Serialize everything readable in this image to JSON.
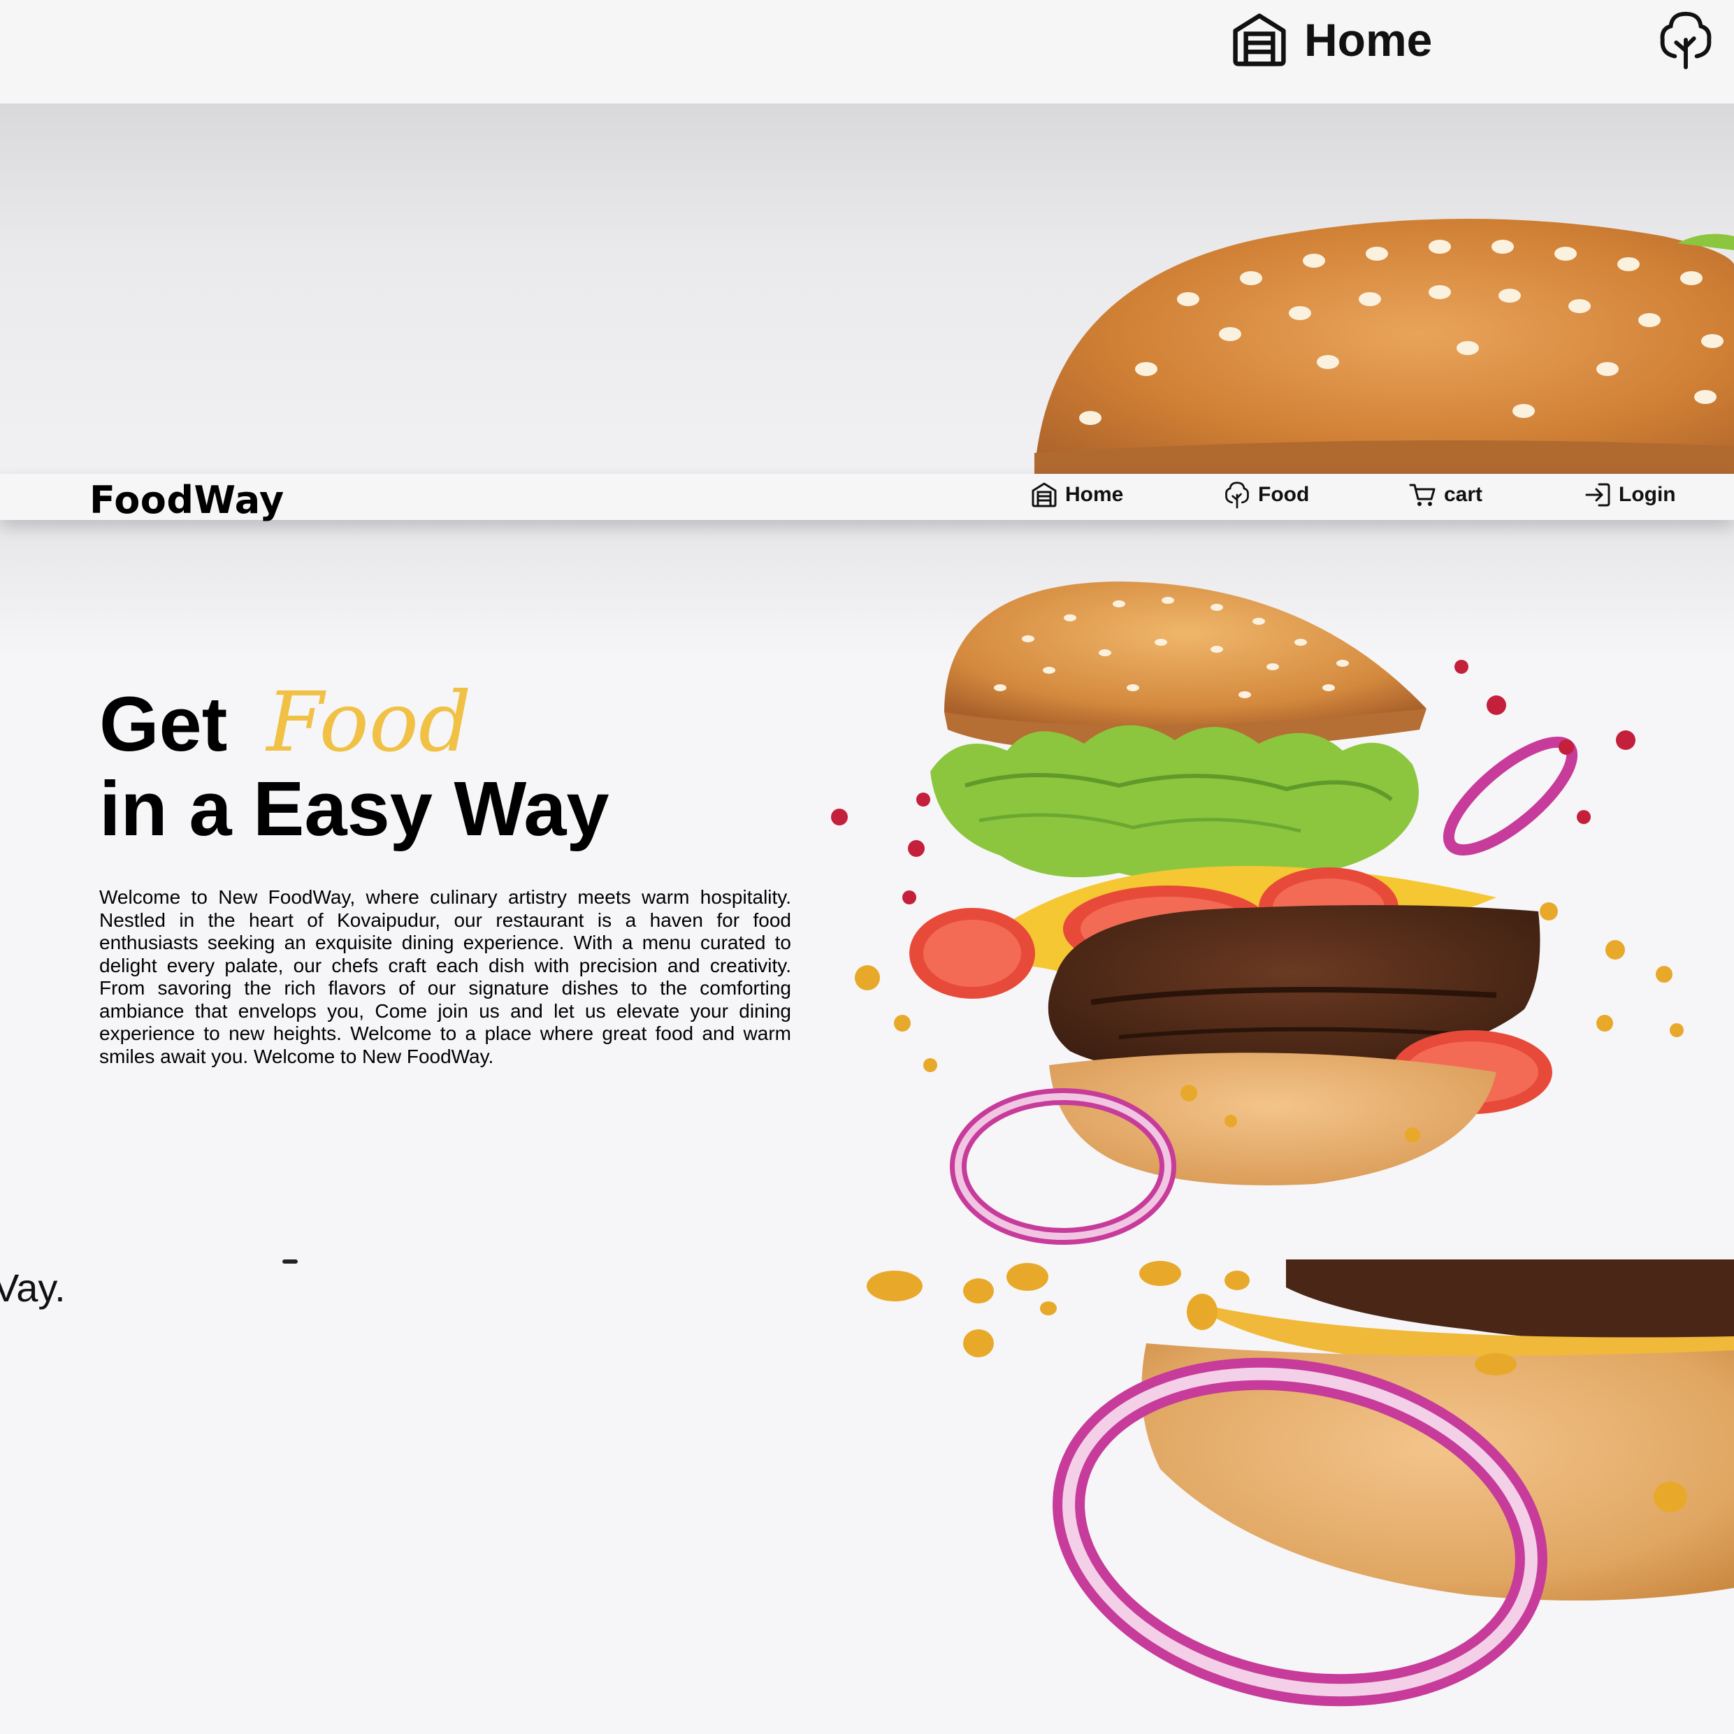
{
  "zoom_top": {
    "home_label": "Home"
  },
  "navbar": {
    "brand": "FoodWay",
    "items": [
      {
        "label": "Home",
        "icon": "home-icon"
      },
      {
        "label": "Food",
        "icon": "tree-icon"
      },
      {
        "label": "cart",
        "icon": "cart-icon"
      },
      {
        "label": "Login",
        "icon": "login-icon"
      }
    ]
  },
  "hero": {
    "heading_get": "Get",
    "heading_food": "Food",
    "heading_line2": "in a Easy Way",
    "intro": "Welcome to New FoodWay, where culinary artistry meets warm hospitality. Nestled in the heart of Kovaipudur, our restaurant is a haven for food enthusiasts seeking an exquisite dining experience. With a menu curated to delight every palate, our chefs craft each dish with precision and creativity. From savoring the rich flavors of our signature dishes to the comforting ambiance that envelops you, Come join us and let us elevate your dining experience to new heights. Welcome to a place where great food and warm smiles await you. Welcome to New FoodWay."
  },
  "zoom_bottom": {
    "text_fragment": "Vay."
  },
  "colors": {
    "accent": "#f0c144",
    "background": "#f6f6f8",
    "text": "#000000"
  }
}
